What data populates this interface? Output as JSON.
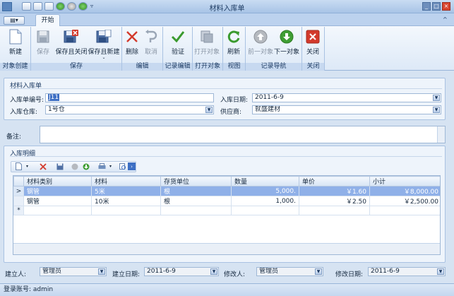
{
  "window": {
    "title": "材料入库单",
    "minimize": "_",
    "maximize": "□",
    "close": "×"
  },
  "app_menu": "▤▾",
  "tabs": [
    "开始"
  ],
  "ribbon": {
    "buttons": {
      "new": "新建",
      "save": "保存",
      "save_close": "保存且关闭",
      "save_new": "保存且新建",
      "delete": "删除",
      "cancel": "取消",
      "verify": "验证",
      "open_object": "打开对象",
      "refresh": "刷新",
      "prev_object": "前一对象",
      "next_object": "下一对象",
      "close": "关闭"
    },
    "groups": {
      "create": "对象创建",
      "save": "保存",
      "edit": "编辑",
      "record_edit": "记录编辑",
      "open_object": "打开对象",
      "view": "视图",
      "record_nav": "记录导航",
      "close": "关闭"
    }
  },
  "form": {
    "section_title": "材料入库单",
    "receipt_no_label": "入库单编号:",
    "receipt_no_value": "J11",
    "receipt_date_label": "入库日期:",
    "receipt_date_value": "2011-6-9",
    "warehouse_label": "入库仓库:",
    "warehouse_value": "1号仓",
    "supplier_label": "供应商:",
    "supplier_value": "就盛建材",
    "remark_label": "备注:",
    "remark_value": ""
  },
  "detail": {
    "section_title": "入库明细",
    "columns": [
      "材料类别",
      "材料",
      "存货单位",
      "数量",
      "单价",
      "小计"
    ],
    "rows": [
      {
        "category": "钢管",
        "material": "5米",
        "unit": "根",
        "quantity": "5,000.",
        "price": "￥1.60",
        "subtotal": "￥8,000.00",
        "selected": true
      },
      {
        "category": "钢管",
        "material": "10米",
        "unit": "根",
        "quantity": "1,000.",
        "price": "￥2.50",
        "subtotal": "￥2,500.00",
        "selected": false
      }
    ],
    "new_row_marker": "*",
    "current_row_marker": ">"
  },
  "footer": {
    "creator_label": "建立人:",
    "creator_value": "管理员",
    "create_date_label": "建立日期:",
    "create_date_value": "2011-6-9",
    "modifier_label": "修改人:",
    "modifier_value": "管理员",
    "modify_date_label": "修改日期:",
    "modify_date_value": "2011-6-9"
  },
  "status": {
    "login_text": "登录账号: admin"
  },
  "colors": {
    "accent": "#3d6fc4",
    "selected_row": "#8fb0e8",
    "ribbon_bg": "#f4f8fd",
    "delete_red": "#d33a2c",
    "ok_green": "#3a9a2e"
  }
}
